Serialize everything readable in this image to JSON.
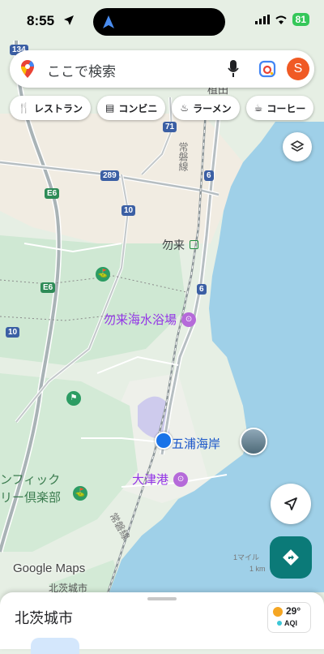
{
  "status": {
    "time": "8:55",
    "battery": "81"
  },
  "search": {
    "placeholder": "ここで検索",
    "avatar_initial": "S"
  },
  "chips": [
    {
      "label": "レストラン",
      "icon": "fork-knife-icon"
    },
    {
      "label": "コンビニ",
      "icon": "store-icon"
    },
    {
      "label": "ラーメン",
      "icon": "ramen-icon"
    },
    {
      "label": "コーヒー",
      "icon": "coffee-icon"
    }
  ],
  "map": {
    "places": {
      "station": "勿来",
      "beach": "勿来海水浴場",
      "current_spot": "五浦海岸",
      "port": "大津港",
      "golf_line1": "ンフィック",
      "golf_line2": "リー倶楽部",
      "rail_top": "常磐線",
      "rail_bottom": "常磐線",
      "top_partial": "植田",
      "bottom_partial": "北茨城市"
    },
    "routes": {
      "r134": "134",
      "r71": "71",
      "r289": "289",
      "r10a": "10",
      "r10b": "10",
      "r6a": "6",
      "r6b": "6",
      "e6a": "E6",
      "e6b": "E6"
    },
    "scale_top": "1マイル",
    "scale_bottom": "1 km",
    "logo": "Google Maps"
  },
  "sheet": {
    "title": "北茨城市",
    "temperature": "29°",
    "aqi_label": "AQI"
  }
}
